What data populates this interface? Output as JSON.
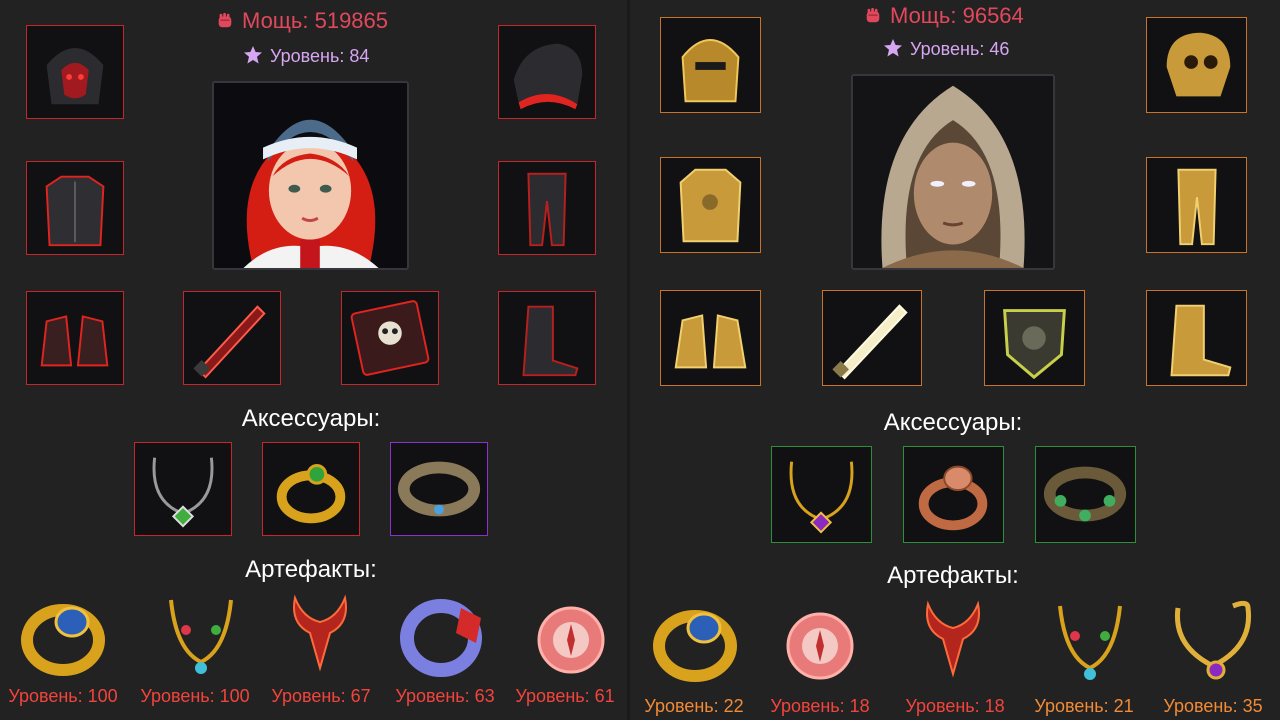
{
  "left": {
    "power_label": "Мощь: 519865",
    "level_label": "Уровень: 84",
    "accessories_heading": "Аксессуары:",
    "artifacts_heading": "Артефакты:",
    "artifacts": [
      {
        "icon": "gold-blue-ring-icon",
        "level_label": "Уровень: 100"
      },
      {
        "icon": "jeweled-necklace-icon",
        "level_label": "Уровень: 100"
      },
      {
        "icon": "demon-horns-amulet-icon",
        "level_label": "Уровень: 67"
      },
      {
        "icon": "crystal-ring-icon",
        "level_label": "Уровень: 63"
      },
      {
        "icon": "pink-compass-icon",
        "level_label": "Уровень: 61"
      }
    ]
  },
  "right": {
    "power_label": "Мощь: 96564",
    "level_label": "Уровень: 46",
    "accessories_heading": "Аксессуары:",
    "artifacts_heading": "Артефакты:",
    "artifacts": [
      {
        "icon": "gold-blue-ring-icon",
        "level_label": "Уровень: 22"
      },
      {
        "icon": "pink-compass-icon",
        "level_label": "Уровень: 18"
      },
      {
        "icon": "demon-horns-amulet-icon",
        "level_label": "Уровень: 18"
      },
      {
        "icon": "jeweled-necklace-icon",
        "level_label": "Уровень: 21"
      },
      {
        "icon": "gold-pendant-necklace-icon",
        "level_label": "Уровень: 35"
      }
    ]
  },
  "colors": {
    "power": "#e2485c",
    "level": "#d7a6f2",
    "red_frame": "#c4262d",
    "orange_frame": "#c8732a",
    "green_frame": "#2e8f3a",
    "purple_frame": "#8a33c9"
  }
}
